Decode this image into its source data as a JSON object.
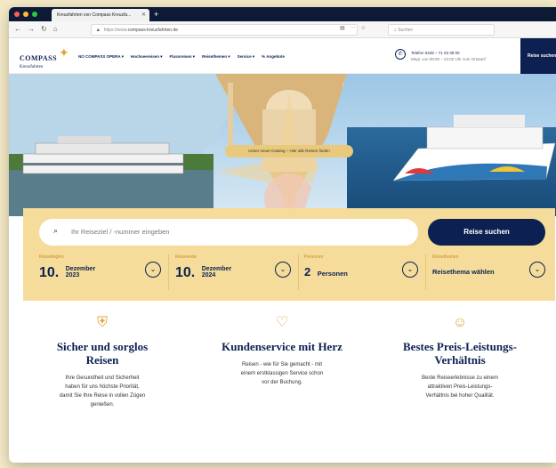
{
  "browser": {
    "tab_title": "Kreuzfahrten von Compass Kreuzfa...",
    "tab_close": "✕",
    "new_tab": "+",
    "url_prefix": "https://www.",
    "url_domain": "compass-kreuzfahrten.de",
    "search_placeholder": "Suchen"
  },
  "header": {
    "logo_main": "COMPASS",
    "logo_sub": "Kreuzfahrten",
    "nav": [
      "NO COMPASS OPERA ▾",
      "Hochseereisen ▾",
      "Flussreisen ▾",
      "Reisethemen ▾",
      "Service ▾",
      "% Angebote"
    ],
    "phone_line1": "Telefon 0228 – 71 03 38 00",
    "phone_line2": "Mögl. von 08:00 – 22:00 Uhr zum Ortstarif",
    "search_tab": "Reise suchen"
  },
  "hero": {
    "badge": "Unser neuer Katalog – Hier alle Reisen finden"
  },
  "booking": {
    "search_placeholder": "Ihr Reiseziel / -nummer eingeben",
    "search_button": "Reise suchen",
    "start_label": "Reisebeginn",
    "start_day": "10.",
    "start_month": "Dezember",
    "start_year": "2023",
    "end_label": "Reiseende",
    "end_day": "10.",
    "end_month": "Dezember",
    "end_year": "2024",
    "persons_label": "Personen",
    "persons_count": "2",
    "persons_text": "Personen",
    "theme_label": "Reisethemen",
    "theme_text": "Reisethema wählen"
  },
  "features": [
    {
      "icon": "shield-hand-icon",
      "title_line1": "Sicher und sorglos",
      "title_line2": "Reisen",
      "text_l1": "Ihre Gesundheit und Sicherheit",
      "text_l2": "haben für uns höchste Priorität,",
      "text_l3": "damit Sie Ihre Reise in vollen Zügen",
      "text_l4": "genießen."
    },
    {
      "icon": "handshake-icon",
      "title_line1": "Kundenservice mit Herz",
      "title_line2": "",
      "text_l1": "Reisen - wie für Sie gemacht - mit",
      "text_l2": "einem erstklassigen Service schon",
      "text_l3": "vor der Buchung.",
      "text_l4": ""
    },
    {
      "icon": "person-service-icon",
      "title_line1": "Bestes Preis-Leistungs-",
      "title_line2": "Verhältnis",
      "text_l1": "Beste Reiseerlebnisse zu einem",
      "text_l2": "attraktiven Preis-Leistungs-",
      "text_l3": "Verhältnis bei hoher Qualität.",
      "text_l4": ""
    }
  ],
  "colors": {
    "navy": "#0c2152",
    "gold": "#e2a53a",
    "panel": "#f5dc9a"
  }
}
